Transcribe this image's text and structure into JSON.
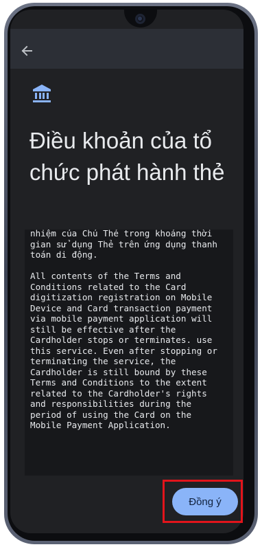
{
  "header": {
    "back_icon": "arrow-left-icon"
  },
  "page": {
    "icon": "bank-icon",
    "title": "Điều khoản của tổ chức phát hành thẻ"
  },
  "terms": {
    "text": "nhiệm của Chủ Thẻ trong khoảng thời\ngian sử dụng Thẻ trên ứng dụng thanh\ntoán di động.\n\nAll contents of the Terms and\nConditions related to the Card\ndigitization registration on Mobile\nDevice and Card transaction payment\nvia mobile payment application will\nstill be effective after the\nCardholder stops or terminates. use\nthis service. Even after stopping or\nterminating the service, the\nCardholder is still bound by these\nTerms and Conditions to the extent\nrelated to the Cardholder's rights\nand responsibilities during the\nperiod of using the Card on the\nMobile Payment Application."
  },
  "actions": {
    "agree_label": "Đồng ý"
  },
  "colors": {
    "accent": "#8ab4f8",
    "background": "#202124",
    "highlight": "#e2141b"
  }
}
